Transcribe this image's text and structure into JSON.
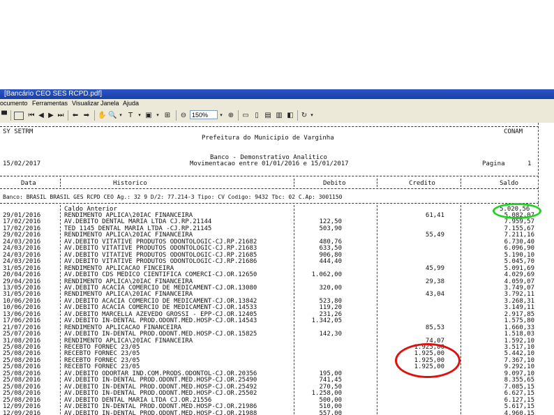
{
  "window": {
    "title": "[Bancário CEO  SES  RCPD.pdf]"
  },
  "menu": [
    "ocumento",
    "Ferramentas",
    "Visualizar",
    "Janela",
    "Ajuda"
  ],
  "toolbar": {
    "zoom": "150%"
  },
  "report": {
    "left_header": "SY SETRM",
    "right_header": "CONAM",
    "org": "Prefeitura do Municipio de Varginha",
    "report_title": "Banco - Demonstrativo Analitico",
    "date": "15/02/2017",
    "period": "Movimentacao entre 01/01/2016 e 15/01/2017",
    "page_label": "Pagina",
    "page_number": "1",
    "columns": {
      "data": "Data",
      "historico": "Historico",
      "debito": "Debito",
      "credito": "Credito",
      "saldo": "Saldo"
    },
    "bank_line": "Banco: BRASIL            BRASIL GES RCPD CEO             Ag.:  32 9 D/2:       77.214-3 Tipo: CV  Codigo: 9432 Tbc: 02  C.Ap: 3001150",
    "saldo_anterior_label": "Caldo Anterior",
    "saldo_anterior_value": "5.020,56",
    "rows": [
      {
        "date": "29/01/2016",
        "hist": "RENDIMENTO APLICA\\20IAC FINANCEIRA",
        "debit": "",
        "credit": "61,41",
        "balance": "5.082,07"
      },
      {
        "date": "17/02/2016",
        "hist": "AV.DEBITO DENTAL MARIA LTDA    CJ.RP.21144",
        "debit": "122,50",
        "credit": "",
        "balance": "7.959,57"
      },
      {
        "date": "17/02/2016",
        "hist": "TED 1145 DENTAL MARIA LTDA     -CJ.RP.21145",
        "debit": "503,90",
        "credit": "",
        "balance": "7.155,67"
      },
      {
        "date": "29/02/2016",
        "hist": "RENDIMENTO APLICA\\20IAC FINANCEIRA",
        "debit": "",
        "credit": "55,49",
        "balance": "7.211,16"
      },
      {
        "date": "24/03/2016",
        "hist": "AV.DEBITO VITATIVE PRODUTOS ODONTOLOGIC-CJ.RP.21682",
        "debit": "480,76",
        "credit": "",
        "balance": "6.730,40"
      },
      {
        "date": "24/03/2016",
        "hist": "AV.DEBITO VITATIVE PRODUTOS ODONTOLOGIC-CJ.RP.21683",
        "debit": "633,50",
        "credit": "",
        "balance": "6.096,90"
      },
      {
        "date": "24/03/2016",
        "hist": "AV.DEBITO VITATIVE PRODUTOS ODONTOLOGIC-CJ.RP.21685",
        "debit": "906,80",
        "credit": "",
        "balance": "5.190,10"
      },
      {
        "date": "24/03/2016",
        "hist": "AV.DEBITO VITATIVE PRODUTOS ODONTOLOGIC-CJ.RP.21686",
        "debit": "444,40",
        "credit": "",
        "balance": "5.045,70"
      },
      {
        "date": "31/05/2016",
        "hist": "RENDIMENTO APLICACAO FINCEIRA",
        "debit": "",
        "credit": "45,99",
        "balance": "5.091,69"
      },
      {
        "date": "20/04/2016",
        "hist": "AV.DEBITO CDS MEDICO CIENTIFICA COMERCI-CJ.OR.12650",
        "debit": "1.062,00",
        "credit": "",
        "balance": "4.029,69"
      },
      {
        "date": "29/04/2016",
        "hist": "RENDIMENTO APLICA\\20IAC FINANCEIRA",
        "debit": "",
        "credit": "29,38",
        "balance": "4.059,07"
      },
      {
        "date": "13/05/2016",
        "hist": "AV.DEBITO ACACIA COMERCIO DE MEDICAMENT-CJ.OR.13080",
        "debit": "320,00",
        "credit": "",
        "balance": "3.749,07"
      },
      {
        "date": "31/05/2016",
        "hist": "RENDIMENTO APLICA\\20IAC FINANCEIRA",
        "debit": "",
        "credit": "43,04",
        "balance": "3.792,11"
      },
      {
        "date": "10/06/2016",
        "hist": "AV.DEBITO ACACIA COMERCIO DE MEDICAMENT-CJ.OR.13842",
        "debit": "523,80",
        "credit": "",
        "balance": "3.268,31"
      },
      {
        "date": "10/06/2016",
        "hist": "AV.DEBITO ACACIA COMERCIO DE MEDICAMENT-CJ.OR.14533",
        "debit": "119,20",
        "credit": "",
        "balance": "3.149,11"
      },
      {
        "date": "13/06/2016",
        "hist": "AV.DEBITO MARCELLA AZEVEDO GROSSI - EPP-CJ.OR.12405",
        "debit": "231,26",
        "credit": "",
        "balance": "2.917,85"
      },
      {
        "date": "17/06/2016",
        "hist": "AV.DEBITO IN-DENTAL PROD.ODONT.MED.HOSP-CJ.OR.14543",
        "debit": "1.342,05",
        "credit": "",
        "balance": "1.575,80"
      },
      {
        "date": "21/07/2016",
        "hist": "RENDIMENTO APLICACAO FINANCEIRA",
        "debit": "",
        "credit": "85,53",
        "balance": "1.660,33"
      },
      {
        "date": "25/07/2016",
        "hist": "AV.DEBITO IN-DENTAL PROD.ODONT.MED.HOSP-CJ.OR.15825",
        "debit": "142,30",
        "credit": "",
        "balance": "1.518,03"
      },
      {
        "date": "31/08/2016",
        "hist": "RENDIMENTO APLICA\\20IAC FINANCEIRA",
        "debit": "",
        "credit": "74,07",
        "balance": "1.592,10"
      },
      {
        "date": "25/08/2016",
        "hist": "RECEBTO FORNEC 23/05",
        "debit": "",
        "credit": "1.925,00",
        "balance": "3.517,10"
      },
      {
        "date": "25/08/2016",
        "hist": "RECEBTO FORNEC 23/05",
        "debit": "",
        "credit": "1.925,00",
        "balance": "5.442,10"
      },
      {
        "date": "25/08/2016",
        "hist": "RECEBTO FORNEC 23/05",
        "debit": "",
        "credit": "1.925,00",
        "balance": "7.367,10"
      },
      {
        "date": "25/08/2016",
        "hist": "RECEBTO FORNEC 23/05",
        "debit": "",
        "credit": "1.925,00",
        "balance": "9.292,10"
      },
      {
        "date": "25/08/2016",
        "hist": "AV.DEBITO ODORTAR IND.COM.PRODS.ODONTOL-CJ.OR.20356",
        "debit": "195,00",
        "credit": "",
        "balance": "9.097,10"
      },
      {
        "date": "25/08/2016",
        "hist": "AV.DEBITO IN-DENTAL PROD.ODONT.MED.HOSP-CJ.OR.25490",
        "debit": "741,45",
        "credit": "",
        "balance": "8.355,65"
      },
      {
        "date": "25/08/2016",
        "hist": "AV.DEBITO IN-DENTAL PROD.ODONT.MED.HOSP-CJ.OR.25492",
        "debit": "270,50",
        "credit": "",
        "balance": "7.085,15"
      },
      {
        "date": "25/08/2016",
        "hist": "AV.DEBITO IN-DENTAL PROD.ODONT.MED.HOSP-CJ.OR.25502",
        "debit": "1.258,00",
        "credit": "",
        "balance": "6.627,15"
      },
      {
        "date": "25/08/2016",
        "hist": "AV.DEBITO DENTAL MARIA LTDA    CJ.OR.21556",
        "debit": "500,00",
        "credit": "",
        "balance": "6.127,15"
      },
      {
        "date": "12/09/2016",
        "hist": "AV.DEBITO IN-DENTAL PROD.ODONT.MED.HOSP-CJ.OR.21986",
        "debit": "510,00",
        "credit": "",
        "balance": "5.617,15"
      },
      {
        "date": "12/09/2016",
        "hist": "AV.DEBITO IN-DENTAL PROD.ODONT.MED.HOSP-CJ.OR.21988",
        "debit": "557,00",
        "credit": "",
        "balance": "4.960,15"
      }
    ]
  }
}
